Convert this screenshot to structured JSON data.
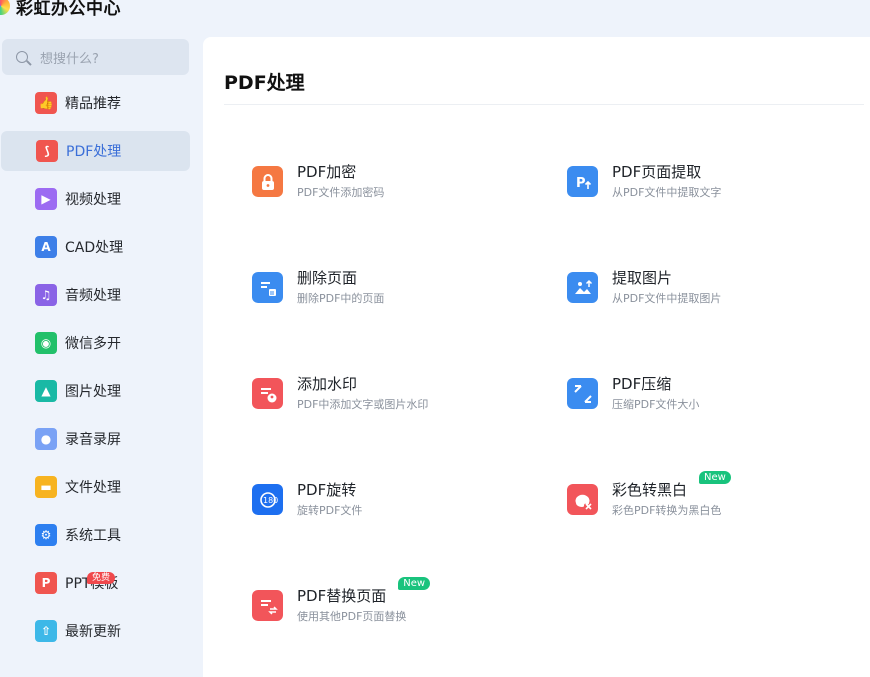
{
  "app": {
    "name": "彩虹办公中心"
  },
  "search": {
    "placeholder": "想搜什么?"
  },
  "sidebar": {
    "items": [
      {
        "label": "精品推荐",
        "icon": "thumbs-up-icon",
        "color": "#f0554f",
        "glyph": "👍"
      },
      {
        "label": "PDF处理",
        "icon": "pdf-icon",
        "color": "#f0554f",
        "glyph": "⟆",
        "active": true
      },
      {
        "label": "视频处理",
        "icon": "video-play-icon",
        "color": "#9c6bf2",
        "glyph": "▶"
      },
      {
        "label": "CAD处理",
        "icon": "cad-icon",
        "color": "#3d7fe8",
        "glyph": "A"
      },
      {
        "label": "音频处理",
        "icon": "music-note-icon",
        "color": "#8a63e6",
        "glyph": "♫"
      },
      {
        "label": "微信多开",
        "icon": "wechat-icon",
        "color": "#22c06a",
        "glyph": "◉"
      },
      {
        "label": "图片处理",
        "icon": "image-icon",
        "color": "#19b9a5",
        "glyph": "▲"
      },
      {
        "label": "录音录屏",
        "icon": "microphone-icon",
        "color": "#7aa2f5",
        "glyph": "●"
      },
      {
        "label": "文件处理",
        "icon": "folder-icon",
        "color": "#f7b320",
        "glyph": "▬"
      },
      {
        "label": "系统工具",
        "icon": "gear-icon",
        "color": "#2d7ff0",
        "glyph": "⚙"
      },
      {
        "label": "PPT模板",
        "icon": "ppt-icon",
        "color": "#f0554f",
        "glyph": "P",
        "badge": "免费"
      },
      {
        "label": "最新更新",
        "icon": "upload-icon",
        "color": "#3db8e8",
        "glyph": "⇧"
      }
    ]
  },
  "main": {
    "title": "PDF处理",
    "tools": [
      {
        "title": "PDF加密",
        "desc": "PDF文件添加密码",
        "icon": "lock-icon",
        "color": "#f57842"
      },
      {
        "title": "PDF页面提取",
        "desc": "从PDF文件中提取文字",
        "icon": "page-extract-icon",
        "color": "#3b8cf0"
      },
      {
        "title": "删除页面",
        "desc": "删除PDF中的页面",
        "icon": "delete-page-icon",
        "color": "#3b8cf0"
      },
      {
        "title": "提取图片",
        "desc": "从PDF文件中提取图片",
        "icon": "extract-image-icon",
        "color": "#3b8cf0"
      },
      {
        "title": "添加水印",
        "desc": "PDF中添加文字或图片水印",
        "icon": "watermark-icon",
        "color": "#f2555a"
      },
      {
        "title": "PDF压缩",
        "desc": "压缩PDF文件大小",
        "icon": "compress-icon",
        "color": "#3b8cf0"
      },
      {
        "title": "PDF旋转",
        "desc": "旋转PDF文件",
        "icon": "rotate-icon",
        "color": "#1d6ff0"
      },
      {
        "title": "彩色转黑白",
        "desc": "彩色PDF转换为黑白色",
        "icon": "color-to-bw-icon",
        "color": "#f2555a",
        "badge": "New"
      },
      {
        "title": "PDF替换页面",
        "desc": "使用其他PDF页面替换",
        "icon": "replace-page-icon",
        "color": "#f2555a",
        "badge": "New"
      }
    ]
  }
}
